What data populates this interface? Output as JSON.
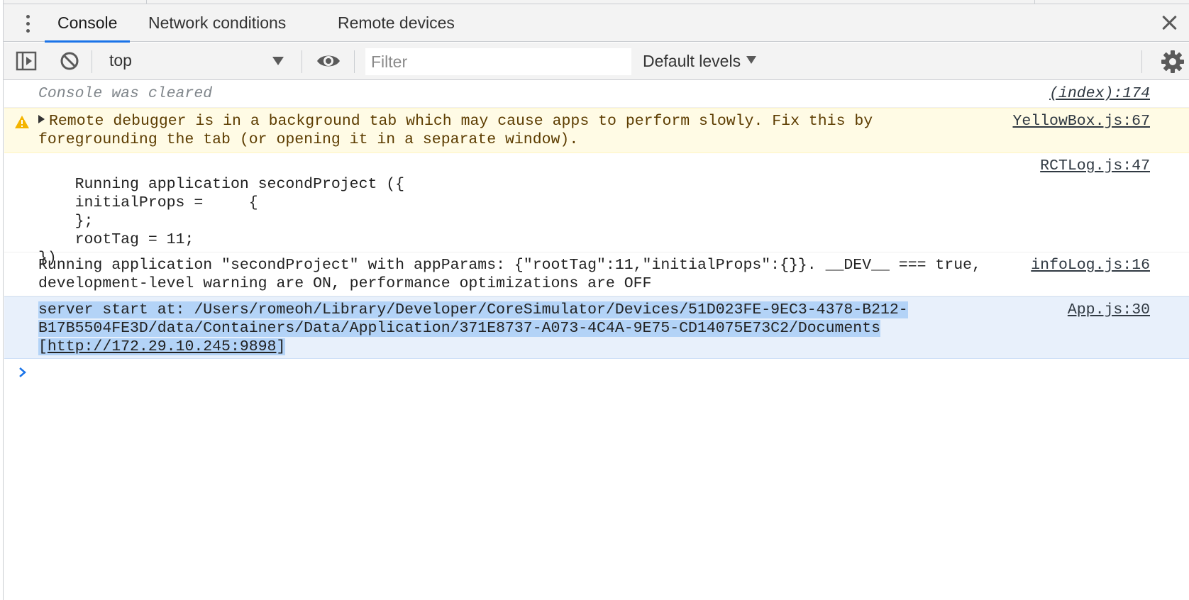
{
  "tabs": [
    {
      "label": "Console",
      "active": true
    },
    {
      "label": "Network conditions",
      "active": false
    },
    {
      "label": "Remote devices",
      "active": false
    }
  ],
  "toolbar": {
    "context": "top",
    "filter_placeholder": "Filter",
    "levels": "Default levels"
  },
  "messages": {
    "cleared": {
      "text": "Console was cleared",
      "source": "(index):174"
    },
    "warning": {
      "text_line1": "Remote debugger is in a background tab which may cause apps to perform slowly. Fix this by",
      "text_line2": "foregrounding the tab (or opening it in a separate window).",
      "source": "YellowBox.js:67"
    },
    "log": {
      "text": "Running application secondProject ({\n    initialProps =     {\n    };\n    rootTag = 11;\n})",
      "source": "RCTLog.js:47"
    },
    "info": {
      "text_line1": "Running application \"secondProject\" with appParams: {\"rootTag\":11,\"initialProps\":{}}. __DEV__ === true,",
      "text_line2": "development-level warning are ON, performance optimizations are OFF",
      "source": "infoLog.js:16"
    },
    "server": {
      "line1": "server start at: /Users/romeoh/Library/Developer/CoreSimulator/Devices/51D023FE-9EC3-4378-B212-",
      "line2": "B17B5504FE3D/data/Containers/Data/Application/371E8737-A073-4C4A-9E75-CD14075E73C2/Documents",
      "bracket_open": "[",
      "link": "http://172.29.10.245:9898",
      "bracket_close": "]",
      "source": "App.js:30"
    }
  },
  "colors": {
    "accent": "#1a73e8",
    "warning_bg": "#fffbe5",
    "selection": "#b3d3f7"
  },
  "icons": [
    "kebab-menu-icon",
    "close-icon",
    "sidebar-toggle-icon",
    "clear-console-icon",
    "eye-icon",
    "gear-icon",
    "warning-icon",
    "expand-triangle-icon",
    "prompt-chevron-icon"
  ]
}
